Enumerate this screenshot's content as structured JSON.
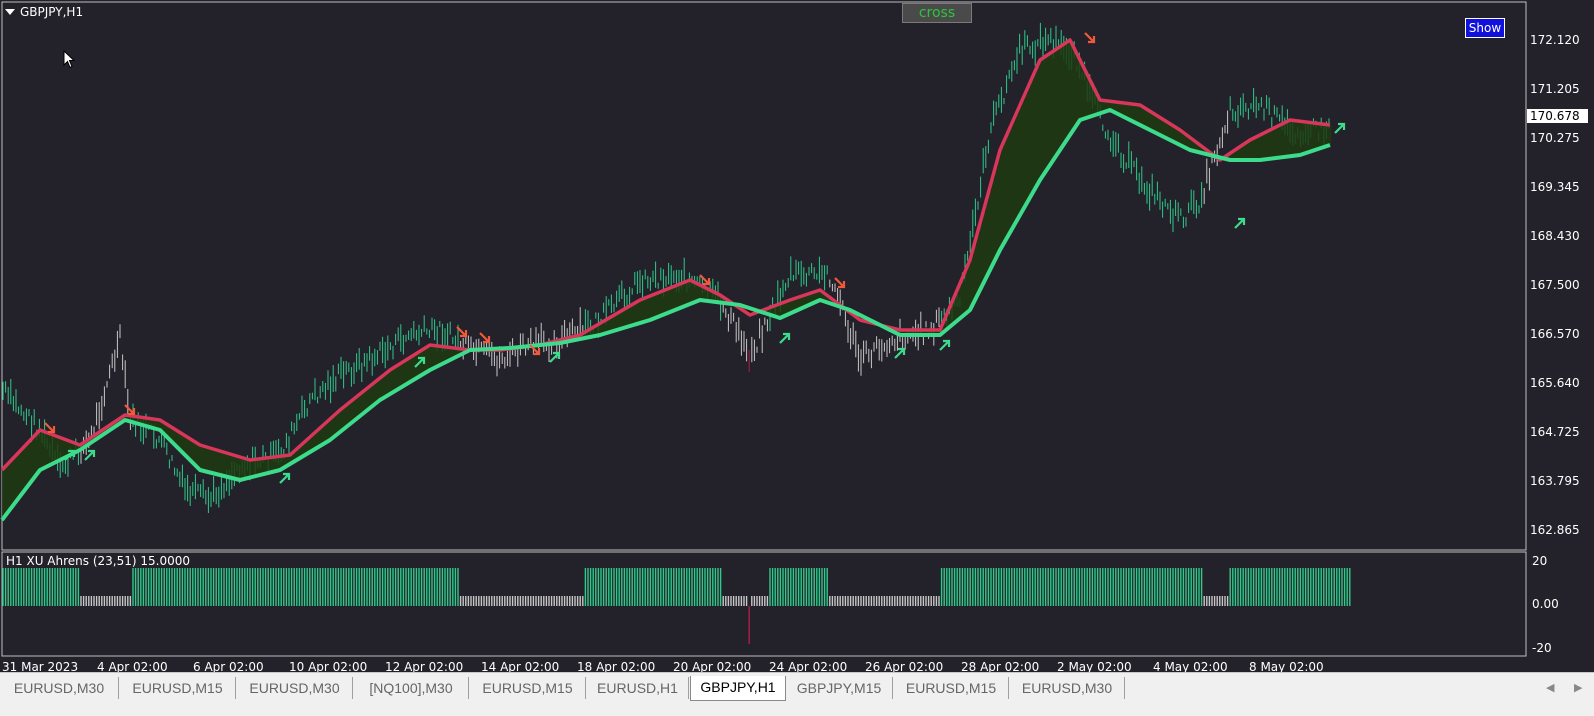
{
  "window": {
    "title": "GBPJPY,H1",
    "cross_button": "cross",
    "show_button": "Show",
    "current_price": "170.678"
  },
  "price_axis": [
    "172.120",
    "171.205",
    "170.275",
    "169.345",
    "168.430",
    "167.500",
    "166.570",
    "165.640",
    "164.725",
    "163.795",
    "162.865"
  ],
  "indicator": {
    "label": "H1 XU Ahrens (23,51) 15.0000",
    "axis": [
      "20",
      "0.00",
      "-20"
    ]
  },
  "time_axis": [
    "31 Mar 2023",
    "4 Apr 02:00",
    "6 Apr 02:00",
    "10 Apr 02:00",
    "12 Apr 02:00",
    "14 Apr 02:00",
    "18 Apr 02:00",
    "20 Apr 02:00",
    "24 Apr 02:00",
    "26 Apr 02:00",
    "28 Apr 02:00",
    "2 May 02:00",
    "4 May 02:00",
    "8 May 02:00"
  ],
  "tabs": [
    {
      "label": "EURUSD,M30",
      "active": false
    },
    {
      "label": "EURUSD,M15",
      "active": false
    },
    {
      "label": "EURUSD,M30",
      "active": false
    },
    {
      "label": "[NQ100],M30",
      "active": false
    },
    {
      "label": "EURUSD,M15",
      "active": false
    },
    {
      "label": "EURUSD,H1",
      "active": false
    },
    {
      "label": "GBPJPY,H1",
      "active": true
    },
    {
      "label": "GBPJPY,M15",
      "active": false
    },
    {
      "label": "EURUSD,M15",
      "active": false
    },
    {
      "label": "EURUSD,M30",
      "active": false
    }
  ],
  "icons": {
    "tab_scroll_left": "chevron-left-icon",
    "tab_scroll_right": "chevron-right-icon",
    "window_menu": "triangle-down-icon",
    "mouse_cursor": "arrow-cursor-icon"
  },
  "colors": {
    "background": "#232129",
    "bull": "#2fc98b",
    "bear": "#b01c47",
    "neutral": "#c8c8c8",
    "fast_ma": "#d8365a",
    "slow_ma": "#3ddc8c",
    "fill_up": "#1f3a12",
    "fill_down": "#3a0808",
    "arrow_down": "#f05a3a",
    "arrow_up": "#3ddc8c"
  }
}
